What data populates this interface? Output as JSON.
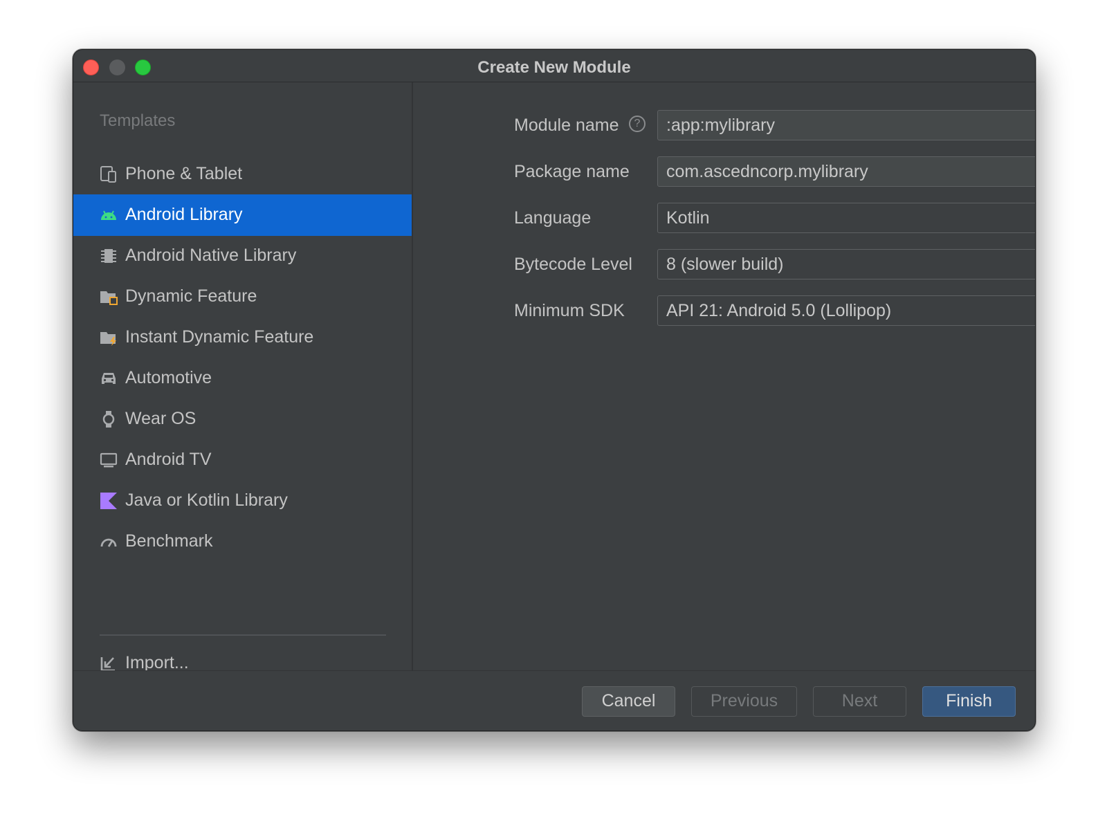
{
  "window": {
    "title": "Create New Module"
  },
  "sidebar": {
    "section_label": "Templates",
    "items": [
      {
        "label": "Phone & Tablet",
        "icon": "phone-tablet-icon",
        "selected": false
      },
      {
        "label": "Android Library",
        "icon": "android-icon",
        "selected": true
      },
      {
        "label": "Android Native Library",
        "icon": "chip-icon",
        "selected": false
      },
      {
        "label": "Dynamic Feature",
        "icon": "folder-feature-icon",
        "selected": false
      },
      {
        "label": "Instant Dynamic Feature",
        "icon": "folder-instant-icon",
        "selected": false
      },
      {
        "label": "Automotive",
        "icon": "car-icon",
        "selected": false
      },
      {
        "label": "Wear OS",
        "icon": "watch-icon",
        "selected": false
      },
      {
        "label": "Android TV",
        "icon": "tv-icon",
        "selected": false
      },
      {
        "label": "Java or Kotlin Library",
        "icon": "kotlin-icon",
        "selected": false
      },
      {
        "label": "Benchmark",
        "icon": "gauge-icon",
        "selected": false
      }
    ],
    "import_label": "Import..."
  },
  "form": {
    "module_name": {
      "label": "Module name",
      "value": ":app:mylibrary"
    },
    "package_name": {
      "label": "Package name",
      "value": "com.ascedncorp.mylibrary"
    },
    "language": {
      "label": "Language",
      "value": "Kotlin"
    },
    "bytecode_level": {
      "label": "Bytecode Level",
      "value": "8 (slower build)"
    },
    "minimum_sdk": {
      "label": "Minimum SDK",
      "value": "API 21: Android 5.0 (Lollipop)"
    }
  },
  "footer": {
    "cancel_label": "Cancel",
    "previous_label": "Previous",
    "next_label": "Next",
    "finish_label": "Finish"
  },
  "colors": {
    "window_bg": "#3c3f41",
    "selection": "#0f66d1",
    "android_green": "#3ddc84",
    "kotlin_purple": "#a97bff",
    "finish_button": "#365880"
  }
}
